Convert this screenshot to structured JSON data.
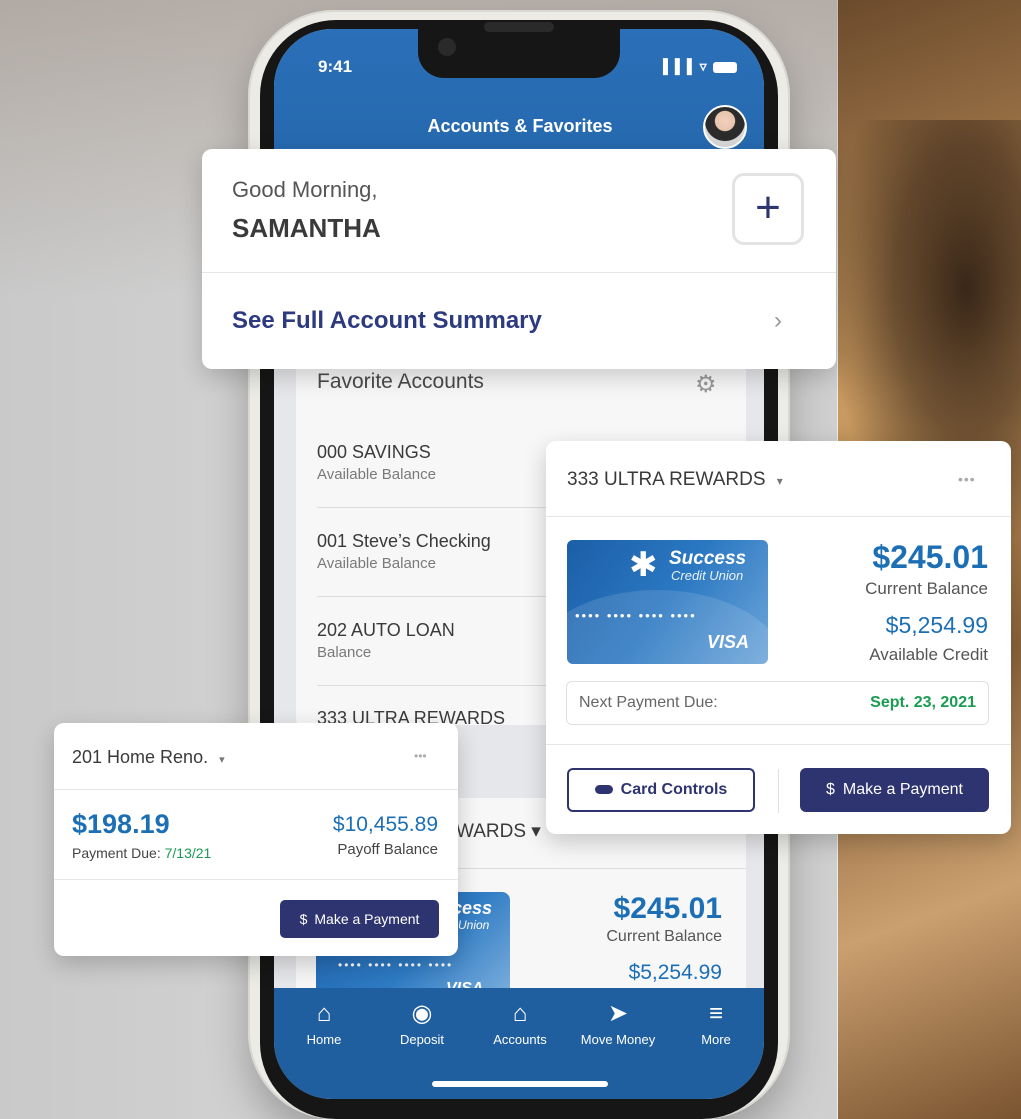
{
  "status_bar": {
    "time": "9:41",
    "icons": "▐▐▐ ▿"
  },
  "header": {
    "title": "Accounts & Favorites"
  },
  "greeting": {
    "hello": "Good Morning,",
    "name": "SAMANTHA",
    "add_symbol": "+",
    "summary_link": "See Full Account Summary",
    "chevron": "›"
  },
  "favorites": {
    "title": "Favorite Accounts",
    "items": [
      {
        "name": "000 SAVINGS",
        "sub": "Available Balance"
      },
      {
        "name": "001 Steve’s Checking",
        "sub": "Available Balance"
      },
      {
        "name": "202 AUTO LOAN",
        "sub": "Balance"
      },
      {
        "name": "333 ULTRA REWARDS",
        "sub": ""
      }
    ]
  },
  "behind_card": {
    "title_fragment": "WARDS ▾",
    "amount": "$245.01",
    "label": "Current Balance",
    "credit": "$5,254.99",
    "brand_fragment": "cess",
    "cu_fragment": "Union",
    "num": "•••• •••• •••• ••••",
    "visa_fragment": "VISA"
  },
  "rewards_card": {
    "title": "333 ULTRA REWARDS",
    "caret": "▾",
    "more": "•••",
    "card_brand": "Success",
    "card_cu": "Credit Union",
    "card_number": "•••• •••• •••• ••••",
    "card_network": "VISA",
    "current_balance": "$245.01",
    "current_balance_label": "Current Balance",
    "available_credit": "$5,254.99",
    "available_credit_label": "Available Credit",
    "next_payment_label": "Next Payment Due:",
    "next_payment_date": "Sept. 23, 2021",
    "card_controls_label": "Card Controls",
    "make_payment_label": "$ Make a Payment"
  },
  "reno_card": {
    "title": "201 Home Reno.",
    "caret": "▾",
    "more": "•••",
    "amount": "$198.19",
    "due_label": "Payment Due: ",
    "due_date": "7/13/21",
    "payoff": "$10,455.89",
    "payoff_label": "Payoff Balance",
    "make_payment_label": "$ Make a Payment"
  },
  "tabbar": {
    "tabs": [
      {
        "label": "Home",
        "icon": "home-icon",
        "glyph": "⌂"
      },
      {
        "label": "Deposit",
        "icon": "camera-icon",
        "glyph": "◉"
      },
      {
        "label": "Accounts",
        "icon": "bank-icon",
        "glyph": "⌂"
      },
      {
        "label": "Move Money",
        "icon": "send-icon",
        "glyph": "➤"
      },
      {
        "label": "More",
        "icon": "menu-icon",
        "glyph": "≡"
      }
    ]
  },
  "colors": {
    "primary": "#1f5f9f",
    "navy": "#2d3470",
    "link": "#2d3a80",
    "amount": "#1c6fb5",
    "success": "#1a9b52"
  }
}
